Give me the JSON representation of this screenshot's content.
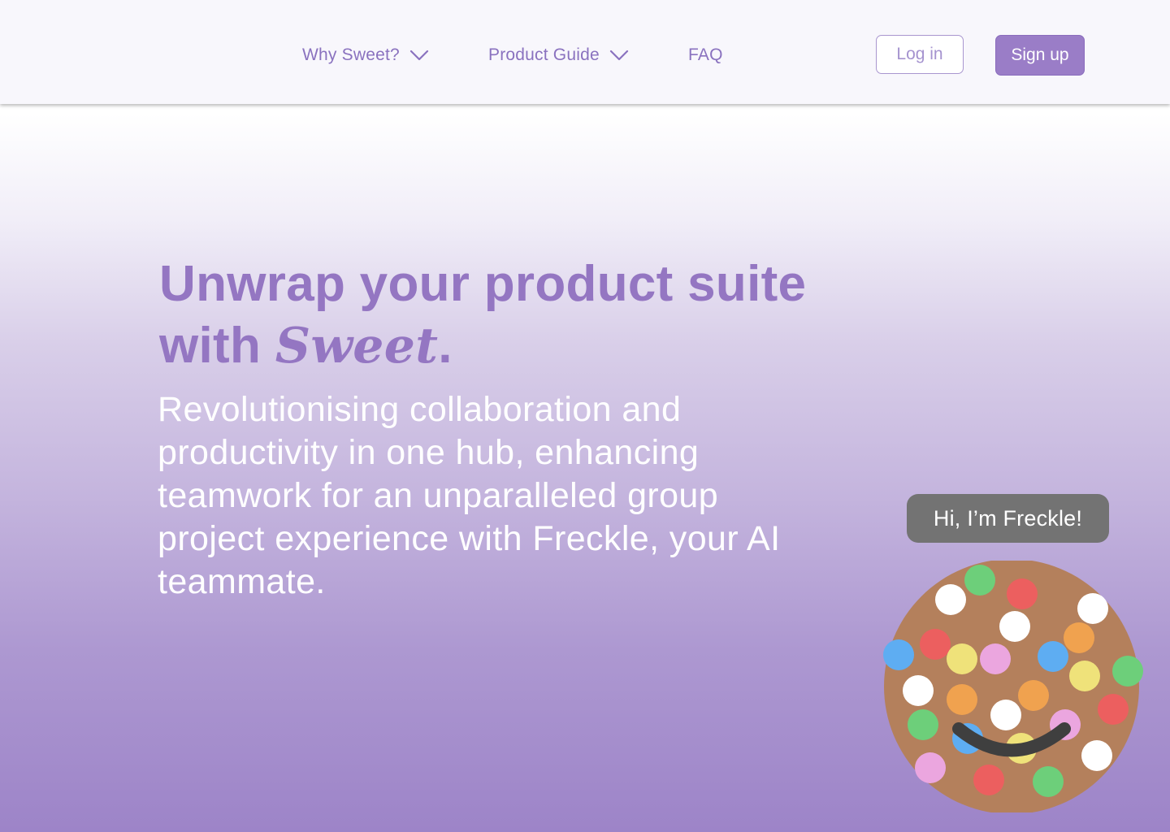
{
  "header": {
    "nav": [
      {
        "label": "Why Sweet?",
        "has_dropdown": true
      },
      {
        "label": "Product Guide",
        "has_dropdown": true
      },
      {
        "label": "FAQ",
        "has_dropdown": false
      }
    ],
    "login_label": "Log in",
    "signup_label": "Sign up"
  },
  "hero": {
    "title_line1": "Unwrap your product suite",
    "title_with": "with ",
    "title_brand": "Sweet",
    "title_period": ".",
    "subtitle": "Revolutionising collaboration and productivity in one hub, enhancing teamwork for an unparalleled group project experience with Freckle, your AI teammate."
  },
  "mascot": {
    "greeting": "Hi, I’m Freckle!",
    "icon": "cookie-mascot-icon"
  },
  "colors": {
    "accent": "#9a7dc7",
    "nav_text": "#8a72bf",
    "bubble": "#737373",
    "cookie": "#b4805c"
  }
}
